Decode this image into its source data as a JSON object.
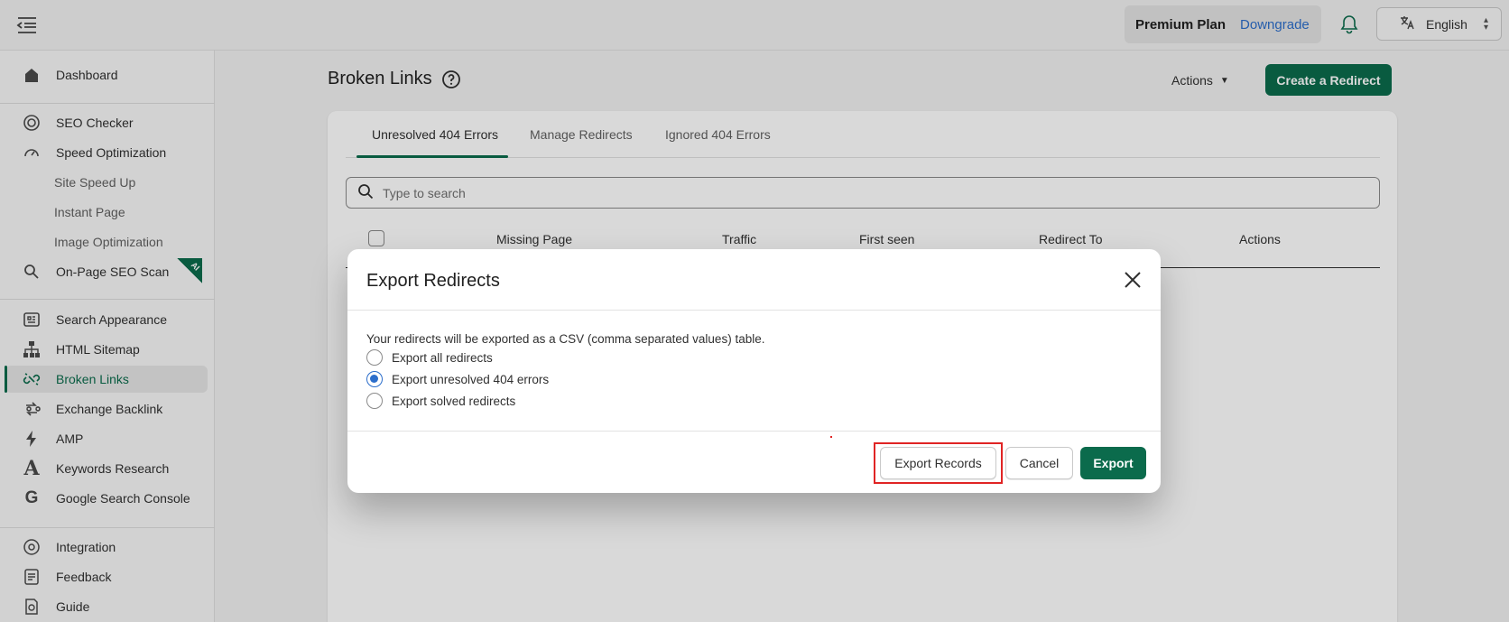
{
  "topbar": {
    "plan_name": "Premium Plan",
    "downgrade_label": "Downgrade",
    "language": "English"
  },
  "sidebar": {
    "items": [
      {
        "label": "Dashboard",
        "icon": "home-icon"
      },
      {
        "label": "SEO Checker",
        "icon": "target-icon"
      },
      {
        "label": "Speed Optimization",
        "icon": "speedometer-icon"
      },
      {
        "label": "Site Speed Up",
        "icon": ""
      },
      {
        "label": "Instant Page",
        "icon": ""
      },
      {
        "label": "Image Optimization",
        "icon": ""
      },
      {
        "label": "On-Page SEO Scan",
        "icon": "search-icon",
        "badge": "AI"
      },
      {
        "label": "Search Appearance",
        "icon": "grid-icon"
      },
      {
        "label": "HTML Sitemap",
        "icon": "sitemap-icon"
      },
      {
        "label": "Broken Links",
        "icon": "broken-link-icon",
        "active": true
      },
      {
        "label": "Exchange Backlink",
        "icon": "exchange-icon"
      },
      {
        "label": "AMP",
        "icon": "lightning-icon"
      },
      {
        "label": "Keywords Research",
        "icon": "letter-a-icon"
      },
      {
        "label": "Google Search Console",
        "icon": "google-icon"
      },
      {
        "label": "Integration",
        "icon": "integration-icon"
      },
      {
        "label": "Feedback",
        "icon": "feedback-icon"
      },
      {
        "label": "Guide",
        "icon": "guide-icon"
      }
    ]
  },
  "main": {
    "title": "Broken Links",
    "actions_label": "Actions",
    "create_label": "Create a Redirect",
    "tabs": [
      "Unresolved 404 Errors",
      "Manage Redirects",
      "Ignored 404 Errors"
    ],
    "search_placeholder": "Type to search",
    "columns": [
      "Missing Page",
      "Traffic",
      "First seen",
      "Redirect To",
      "Actions"
    ]
  },
  "modal": {
    "title": "Export Redirects",
    "description": "Your redirects will be exported as a CSV (comma separated values) table.",
    "options": [
      {
        "label": "Export all redirects",
        "checked": false
      },
      {
        "label": "Export unresolved 404 errors",
        "checked": true
      },
      {
        "label": "Export solved redirects",
        "checked": false
      }
    ],
    "export_records_label": "Export Records",
    "cancel_label": "Cancel",
    "export_label": "Export"
  },
  "colors": {
    "brand": "#0b6b4c",
    "link": "#2c6ecb",
    "highlight": "#e02424"
  }
}
